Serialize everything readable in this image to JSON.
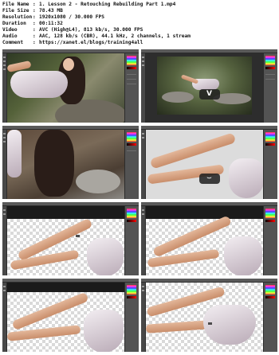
{
  "info": [
    {
      "key": "File Name",
      "value": "1. Lesson 2 - Retouching Rebuilding Part 1.mp4"
    },
    {
      "key": "File Size",
      "value": "78.43 MB"
    },
    {
      "key": "Resolution",
      "value": "1920x1080 / 30.000 FPS"
    },
    {
      "key": "Duration",
      "value": "00:11:32"
    },
    {
      "key": "Video",
      "value": "AVC (High@L4), 813 kb/s, 30.000 FPS"
    },
    {
      "key": "Audio",
      "value": "AAC, 128 kb/s (CBR), 44.1 kHz, 2 channels, 1 stream"
    },
    {
      "key": "Comment",
      "value": "https://xanet.el/blogs/training4all"
    }
  ],
  "separator": ":",
  "thumbnails": [
    {
      "scene": "woman-reclining-rocks",
      "overlay": ""
    },
    {
      "scene": "forest-wide",
      "overlay": "V"
    },
    {
      "scene": "hair-rocks-closeup",
      "overlay": ""
    },
    {
      "scene": "legs-grey-background",
      "overlay": "⌣"
    },
    {
      "scene": "legs-checker-dress",
      "overlay": ""
    },
    {
      "scene": "legs-checker-dress-2",
      "overlay": ""
    },
    {
      "scene": "legs-checker-dark-band",
      "overlay": ""
    },
    {
      "scene": "legs-checker-dress-float",
      "overlay": ""
    }
  ],
  "colors": {
    "app_chrome": "#535353",
    "toolbar": "#484848",
    "swatch_accent": "#ff3b3b"
  }
}
